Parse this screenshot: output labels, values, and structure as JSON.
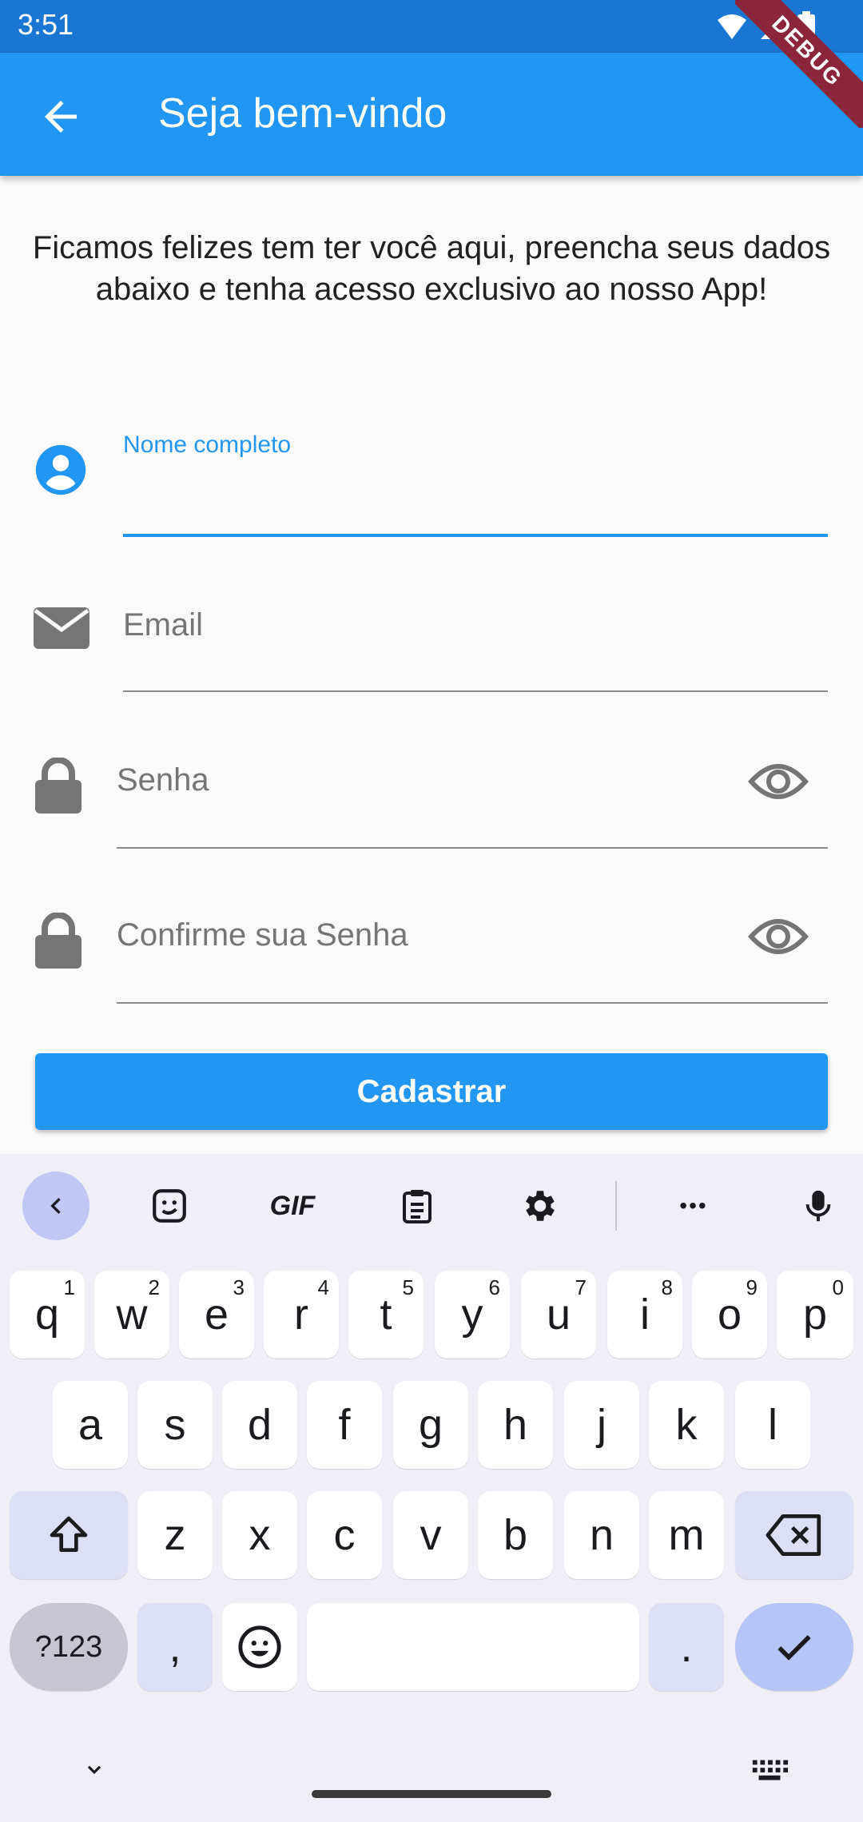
{
  "status_bar": {
    "time": "3:51"
  },
  "app_bar": {
    "title": "Seja bem-vindo",
    "debug_banner": "DEBUG"
  },
  "intro_text": "Ficamos felizes tem ter você aqui, preencha seus dados abaixo e tenha acesso exclusivo ao nosso App!",
  "form": {
    "name_label": "Nome completo",
    "email_placeholder": "Email",
    "password_placeholder": "Senha",
    "confirm_placeholder": "Confirme sua Senha",
    "submit_label": "Cadastrar"
  },
  "keyboard": {
    "toolbar": {
      "gif_label": "GIF",
      "more_label": "•••"
    },
    "row1": [
      {
        "key": "q",
        "sup": "1"
      },
      {
        "key": "w",
        "sup": "2"
      },
      {
        "key": "e",
        "sup": "3"
      },
      {
        "key": "r",
        "sup": "4"
      },
      {
        "key": "t",
        "sup": "5"
      },
      {
        "key": "y",
        "sup": "6"
      },
      {
        "key": "u",
        "sup": "7"
      },
      {
        "key": "i",
        "sup": "8"
      },
      {
        "key": "o",
        "sup": "9"
      },
      {
        "key": "p",
        "sup": "0"
      }
    ],
    "row2": [
      "a",
      "s",
      "d",
      "f",
      "g",
      "h",
      "j",
      "k",
      "l"
    ],
    "row3": [
      "z",
      "x",
      "c",
      "v",
      "b",
      "n",
      "m"
    ],
    "symbols_label": "?123",
    "comma_label": ",",
    "period_label": "."
  },
  "accent_color": "#2196f3"
}
